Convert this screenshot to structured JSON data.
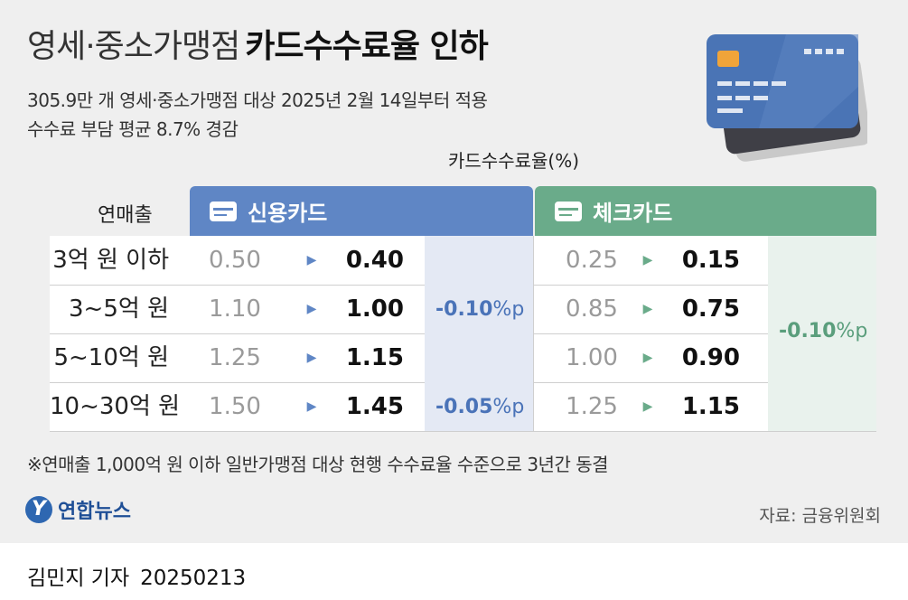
{
  "title": {
    "light": "영세·중소가맹점",
    "bold": "카드수수료율 인하"
  },
  "subtitle": {
    "line1": "305.9만 개 영세·중소가맹점 대상 2025년 2월 14일부터 적용",
    "line2": "수수료 부담 평균 8.7% 경감"
  },
  "unit_label": "카드수수료율(%)",
  "table": {
    "row_header": "연매출",
    "credit_header": "신용카드",
    "check_header": "체크카드",
    "arrow": "▶",
    "rows": [
      {
        "revenue": "3억 원 이하",
        "credit_old": "0.50",
        "credit_new": "0.40",
        "check_old": "0.25",
        "check_new": "0.15"
      },
      {
        "revenue": "3~5억 원",
        "credit_old": "1.10",
        "credit_new": "1.00",
        "check_old": "0.85",
        "check_new": "0.75"
      },
      {
        "revenue": "5~10억 원",
        "credit_old": "1.25",
        "credit_new": "1.15",
        "check_old": "1.00",
        "check_new": "0.90"
      },
      {
        "revenue": "10~30억 원",
        "credit_old": "1.50",
        "credit_new": "1.45",
        "check_old": "1.25",
        "check_new": "1.15"
      }
    ],
    "credit_change_1": {
      "value": "-0.10",
      "unit": "%p"
    },
    "credit_change_2": {
      "value": "-0.05",
      "unit": "%p"
    },
    "check_change": {
      "value": "-0.10",
      "unit": "%p"
    }
  },
  "footnote": "※연매출 1,000억 원 이하 일반가맹점 대상 현행 수수료율 수준으로 3년간 동결",
  "logo": {
    "mark": "Y",
    "text": "연합뉴스"
  },
  "source": "자료: 금융위원회",
  "byline": {
    "author": "김민지 기자",
    "date": "20250213"
  },
  "colors": {
    "credit": "#5f86c5",
    "check": "#6aab8a",
    "card_art": "#4a74b5"
  }
}
